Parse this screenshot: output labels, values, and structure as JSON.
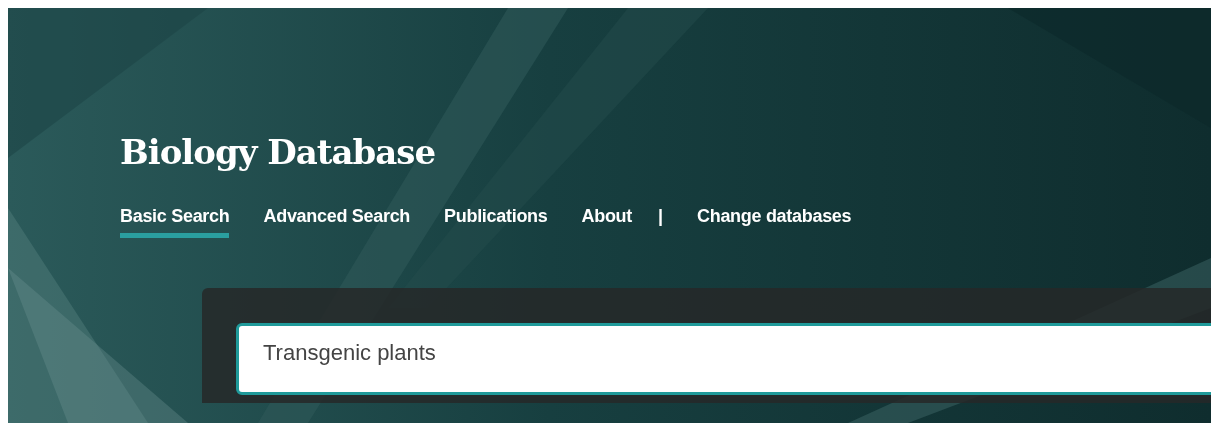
{
  "site": {
    "title": "Biology Database"
  },
  "nav": [
    {
      "kind": "link",
      "label": "Basic Search",
      "selected": true
    },
    {
      "kind": "link",
      "label": "Advanced Search",
      "selected": false
    },
    {
      "kind": "link",
      "label": "Publications",
      "selected": false
    },
    {
      "kind": "link",
      "label": "About",
      "selected": false
    },
    {
      "kind": "separator",
      "label": "|"
    },
    {
      "kind": "link",
      "label": "Change databases",
      "selected": false
    }
  ],
  "search": {
    "value": "Transgenic plants"
  }
}
